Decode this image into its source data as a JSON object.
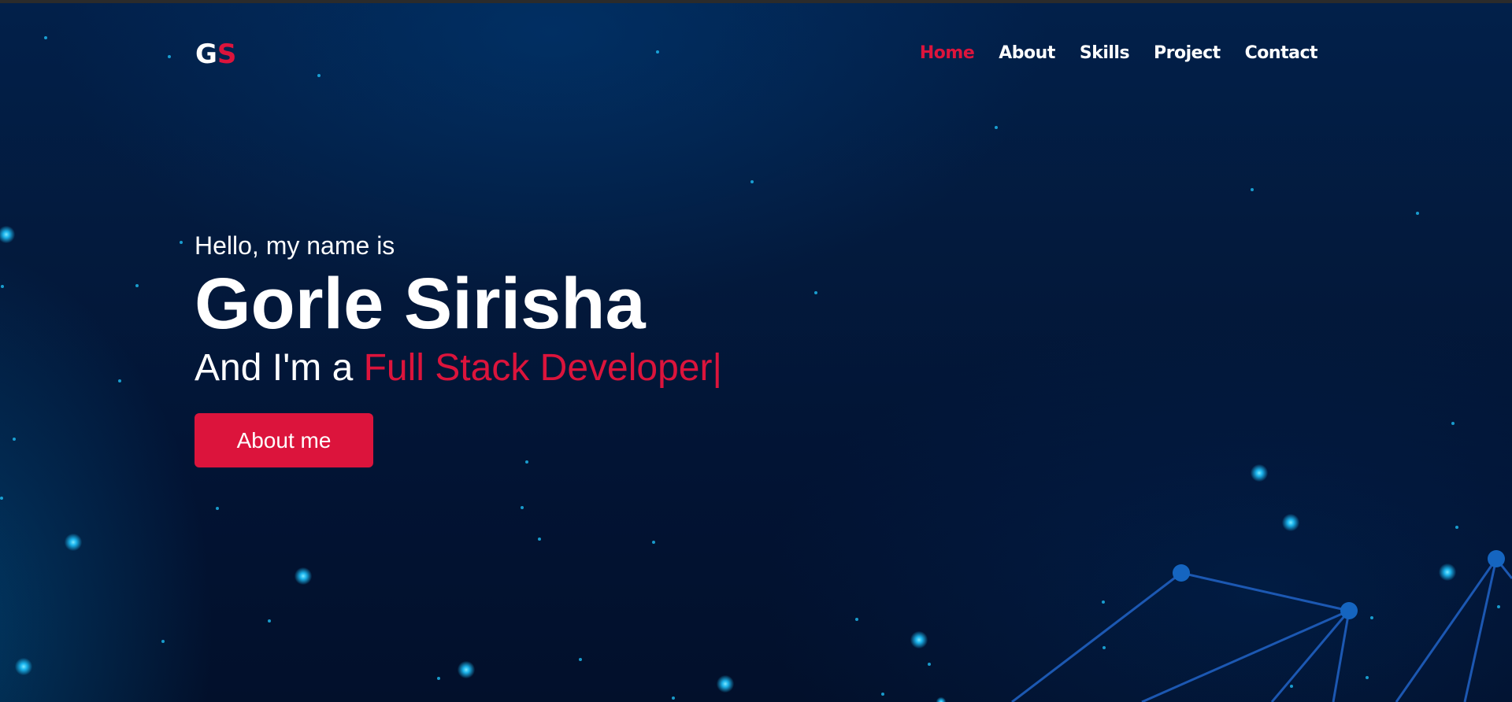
{
  "logo": {
    "first": "G",
    "second": "S"
  },
  "nav": {
    "items": [
      {
        "label": "Home",
        "active": true
      },
      {
        "label": "About",
        "active": false
      },
      {
        "label": "Skills",
        "active": false
      },
      {
        "label": "Project",
        "active": false
      },
      {
        "label": "Contact",
        "active": false
      }
    ]
  },
  "hero": {
    "greeting": "Hello, my name is",
    "name": "Gorle Sirisha",
    "role_prefix": "And I'm a ",
    "role_highlight": "Full Stack Developer|",
    "cta_label": "About me"
  },
  "colors": {
    "accent": "#dc143c",
    "background": "#031a3d",
    "text": "#ffffff",
    "particle": "#22c8ff",
    "network_line": "#1f5fbf"
  }
}
